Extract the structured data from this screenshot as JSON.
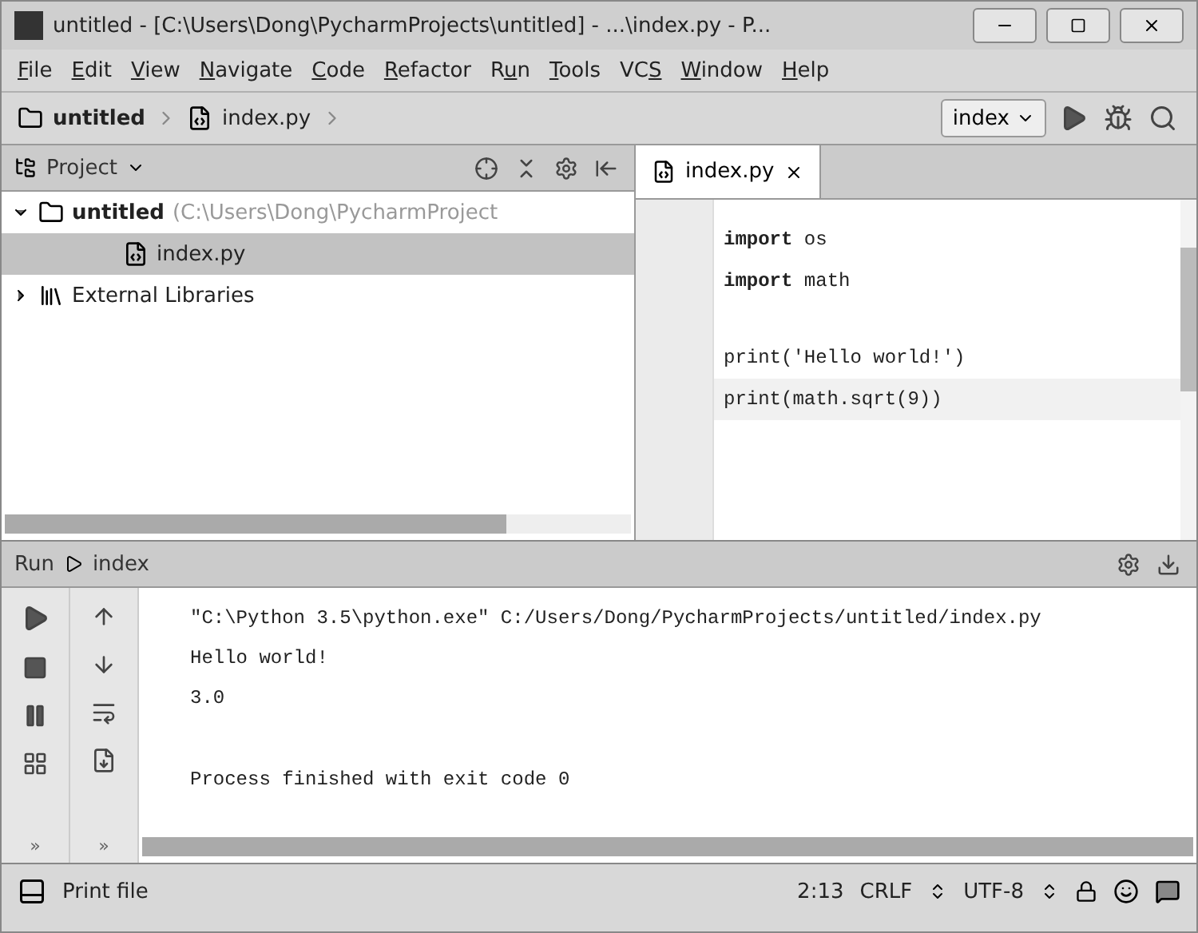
{
  "window": {
    "title": "untitled - [C:\\Users\\Dong\\PycharmProjects\\untitled] - ...\\index.py - P..."
  },
  "menu": [
    {
      "key": "F",
      "post": "ile"
    },
    {
      "key": "E",
      "post": "dit"
    },
    {
      "key": "V",
      "post": "iew"
    },
    {
      "key": "N",
      "post": "avigate"
    },
    {
      "key": "C",
      "post": "ode"
    },
    {
      "key": "R",
      "post": "efactor"
    },
    {
      "pre": "R",
      "key": "u",
      "post": "n"
    },
    {
      "key": "T",
      "post": "ools"
    },
    {
      "pre": "VC",
      "key": "S"
    },
    {
      "key": "W",
      "post": "indow"
    },
    {
      "key": "H",
      "post": "elp"
    }
  ],
  "breadcrumbs": [
    {
      "label": "untitled",
      "kind": "folder"
    },
    {
      "label": "index.py",
      "kind": "file"
    }
  ],
  "run_config": {
    "label": "index"
  },
  "project_panel": {
    "title": "Project",
    "tree": [
      {
        "label": "untitled",
        "path": "(C:\\Users\\Dong\\PycharmProject",
        "kind": "folder",
        "expanded": true,
        "selected": false,
        "children": [
          {
            "label": "index.py",
            "kind": "file",
            "selected": true
          }
        ]
      },
      {
        "label": "External Libraries",
        "kind": "library",
        "expanded": false,
        "selected": false
      }
    ]
  },
  "editor": {
    "tabs": [
      {
        "label": "index.py",
        "selected": true
      }
    ],
    "blocks": [
      [
        {
          "text": "**import** os",
          "current": false
        },
        {
          "text": "**import** math",
          "current": false
        }
      ],
      [
        {
          "text": "print('Hello world!')",
          "current": false
        },
        {
          "text": "print(math.sqrt(9))",
          "current": true
        }
      ]
    ]
  },
  "run_panel": {
    "title": "Run",
    "config": "index",
    "blocks": [
      [
        "\"C:\\Python 3.5\\python.exe\" C:/Users/Dong/PycharmProjects/untitled/index.py",
        "Hello world!",
        "3.0"
      ],
      [
        "Process finished with exit code 0"
      ]
    ],
    "more": "»"
  },
  "status_bar": {
    "message": "Print file",
    "position": "2:13",
    "line_separator": "CRLF",
    "encoding": "UTF-8"
  }
}
